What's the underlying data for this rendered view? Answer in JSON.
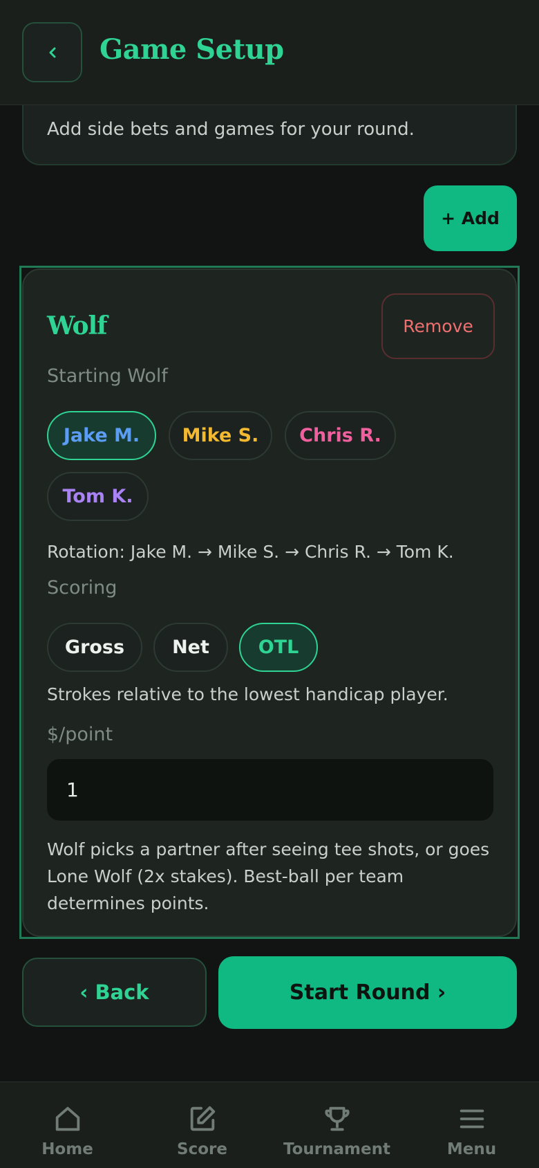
{
  "header": {
    "title": "Game Setup"
  },
  "intro": {
    "text": "Add side bets and games for your round."
  },
  "add_button": "+ Add",
  "game": {
    "name": "Wolf",
    "remove_label": "Remove",
    "starting_wolf_label": "Starting Wolf",
    "players": [
      {
        "name": "Jake M.",
        "color": "#5b9cf5",
        "selected": true
      },
      {
        "name": "Mike S.",
        "color": "#f2b931",
        "selected": false
      },
      {
        "name": "Chris R.",
        "color": "#f0609e",
        "selected": false
      },
      {
        "name": "Tom K.",
        "color": "#a983f5",
        "selected": false
      }
    ],
    "rotation": "Rotation: Jake M. → Mike S. → Chris R. → Tom K.",
    "scoring_label": "Scoring",
    "scoring_options": [
      {
        "label": "Gross",
        "selected": false
      },
      {
        "label": "Net",
        "selected": false
      },
      {
        "label": "OTL",
        "selected": true
      }
    ],
    "scoring_note": "Strokes relative to the lowest handicap player.",
    "point_label": "$/point",
    "point_value": "1",
    "description": "Wolf picks a partner after seeing tee shots, or goes Lone Wolf (2x stakes). Best-ball per team determines points."
  },
  "footer": {
    "back_label": "‹ Back",
    "start_label": "Start Round ›"
  },
  "nav": [
    {
      "label": "Home",
      "icon": "home-icon"
    },
    {
      "label": "Score",
      "icon": "edit-icon"
    },
    {
      "label": "Tournament",
      "icon": "trophy-icon"
    },
    {
      "label": "Menu",
      "icon": "menu-icon"
    }
  ],
  "colors": {
    "accent": "#10b981",
    "accent_text": "#2fd394",
    "danger": "#f07070"
  }
}
